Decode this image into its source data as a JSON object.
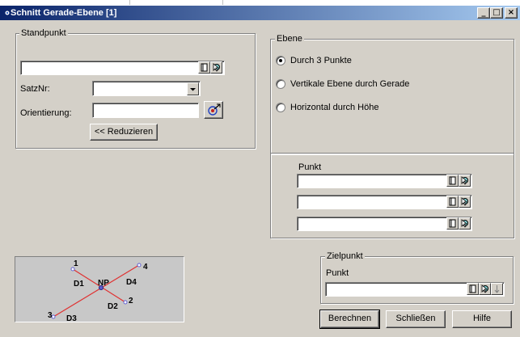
{
  "window": {
    "title": "Schnitt Gerade-Ebene [1]",
    "controls": {
      "minimize": "_",
      "maximize": "□",
      "close": "×"
    }
  },
  "standpunkt": {
    "label": "Standpunkt",
    "input_value": "",
    "satznr_label": "SatzNr:",
    "satznr_value": "",
    "orientierung_label": "Orientierung:",
    "orientierung_value": "",
    "reduce_button": "<< Reduzieren"
  },
  "ebene": {
    "label": "Ebene",
    "options": [
      "Durch 3 Punkte",
      "Vertikale Ebene durch Gerade",
      "Horizontal durch Höhe"
    ],
    "selected_index": 0
  },
  "punkt_group": {
    "label": "Punkt",
    "values": [
      "",
      "",
      ""
    ]
  },
  "zielpunkt": {
    "label": "Zielpunkt",
    "punkt_label": "Punkt",
    "punkt_value": ""
  },
  "diagram": {
    "labels": [
      "1",
      "2",
      "3",
      "4",
      "D1",
      "D2",
      "D3",
      "D4",
      "NP"
    ],
    "colors": {
      "line": "#e03030",
      "point": "#6060d0"
    }
  },
  "buttons": {
    "berechnen": "Berechnen",
    "schliessen": "Schließen",
    "hilfe": "Hilfe"
  },
  "icon_names": [
    "window-icon",
    "book-icon",
    "pick-cursor-icon",
    "target-icon"
  ]
}
